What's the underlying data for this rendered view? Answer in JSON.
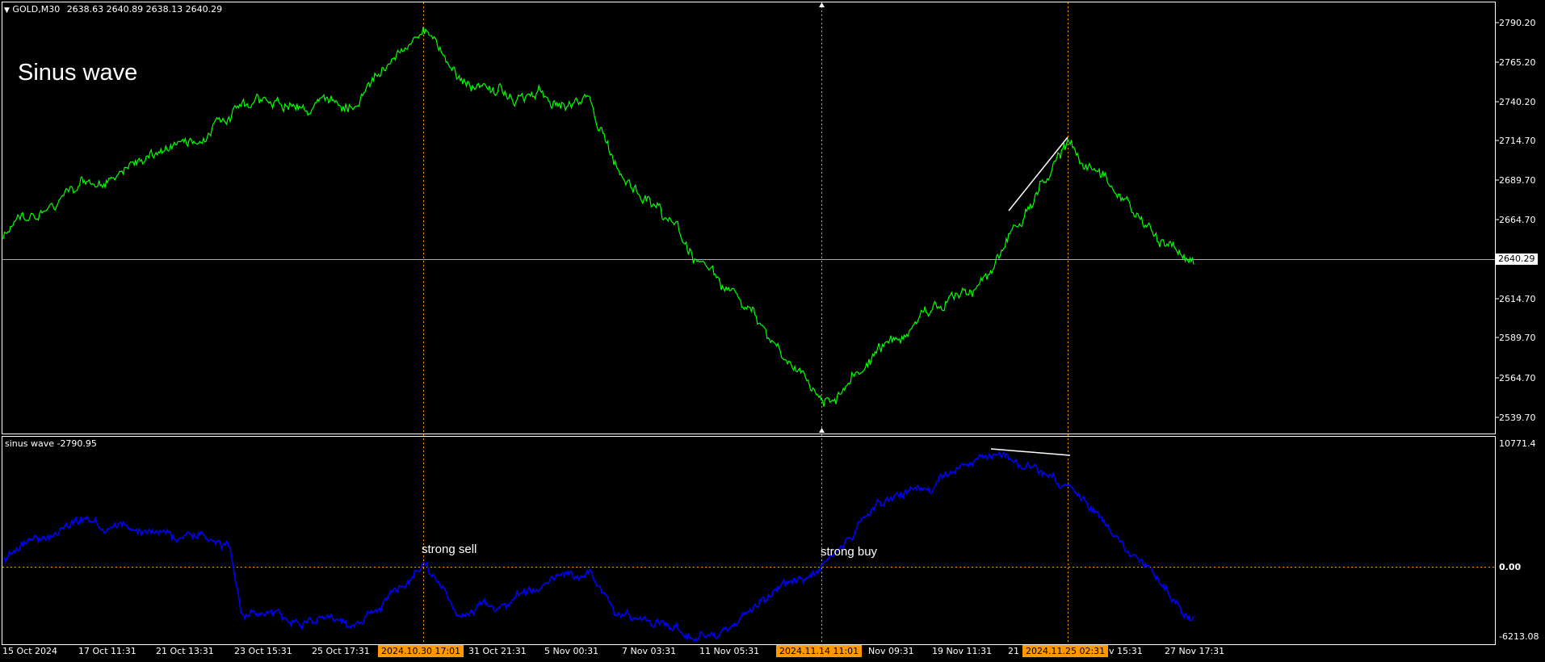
{
  "header": {
    "symbol_label": "GOLD,M30",
    "ohlc": "2638.63 2640.89 2638.13 2640.29",
    "menu_arrow_icon": "triangle-down-icon"
  },
  "overlay_title": "Sinus wave",
  "colors": {
    "background": "#000000",
    "price_line": "#00ff00",
    "indicator_line": "#0000ff",
    "grid_vertical": "#ff9900",
    "zero_line": "#ff9900",
    "border": "#ffffff",
    "date_highlight": "#ff9900"
  },
  "price_axis": {
    "ticks": [
      "2790.20",
      "2765.20",
      "2740.20",
      "2714.70",
      "2689.70",
      "2664.70",
      "2639.70",
      "2614.70",
      "2589.70",
      "2564.70",
      "2539.70"
    ],
    "current_price": "2640.29"
  },
  "indicator": {
    "label": "sinus wave -2790.95",
    "ticks": [
      "10771.4",
      "0.00",
      "-6213.08"
    ]
  },
  "time_axis": {
    "labels": [
      "15 Oct 2024",
      "17 Oct 11:31",
      "21 Oct 13:31",
      "23 Oct 15:31",
      "25 Oct 17:31",
      "31 Oct 21:31",
      "5 Nov 00:31",
      "7 Nov 03:31",
      "11 Nov 05:31",
      "Nov 09:31",
      "19 Nov 11:31",
      "21",
      "v 15:31",
      "27 Nov 17:31"
    ],
    "highlighted": [
      "2024.10.30 17:01",
      "2024.11.14 11:01",
      "2024.11.25 02:31"
    ]
  },
  "annotations": {
    "strong_sell": "strong sell",
    "strong_buy": "strong buy"
  },
  "chart_data": [
    {
      "type": "line",
      "x": [
        "15 Oct 2024",
        "17 Oct 11:31",
        "21 Oct 13:31",
        "23 Oct 15:31",
        "25 Oct 17:31",
        "2024.10.30 17:01",
        "31 Oct 21:31",
        "5 Nov 00:31",
        "7 Nov 03:31",
        "11 Nov 05:31",
        "2024.11.14 11:01",
        "Nov 09:31",
        "19 Nov 11:31",
        "2024.11.25 02:31",
        "27 Nov 17:31"
      ],
      "series": [
        {
          "values": [
            2655,
            2682,
            2722,
            2740,
            2733,
            2787,
            2748,
            2738,
            2700,
            2627,
            2548,
            2583,
            2628,
            2712,
            2636
          ]
        }
      ],
      "ylim": [
        2530,
        2800
      ]
    },
    {
      "type": "line",
      "x": [
        "15 Oct 2024",
        "17 Oct 11:31",
        "21 Oct 13:31",
        "23 Oct 15:31",
        "25 Oct 17:31",
        "2024.10.30 17:01",
        "31 Oct 21:31",
        "5 Nov 00:31",
        "7 Nov 03:31",
        "11 Nov 05:31",
        "2024.11.14 11:01",
        "Nov 09:31",
        "19 Nov 11:31",
        "2024.11.25 02:31",
        "27 Nov 17:31"
      ],
      "series": [
        {
          "name": "sinus wave",
          "values": [
            1000,
            4500,
            1800,
            -4300,
            -5200,
            0,
            -4500,
            -400,
            -4300,
            -5800,
            0,
            5000,
            10000,
            7100,
            -4400
          ]
        }
      ],
      "ylim": [
        -6900,
        11500
      ]
    }
  ]
}
